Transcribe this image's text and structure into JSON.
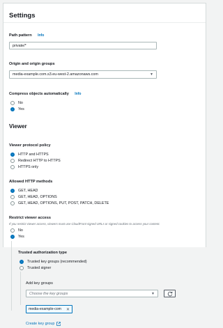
{
  "settings": {
    "title": "Settings"
  },
  "path_pattern": {
    "label": "Path pattern",
    "info": "Info",
    "value": "private/*"
  },
  "origin": {
    "label": "Origin and origin groups",
    "value": "media-example.com.s3.eu-west-2.amazonaws.com"
  },
  "compress": {
    "label": "Compress objects automatically",
    "info": "Info",
    "options": [
      "No",
      "Yes"
    ],
    "selected": "Yes"
  },
  "viewer": {
    "title": "Viewer",
    "protocol": {
      "label": "Viewer protocol policy",
      "options": [
        "HTTP and HTTPS",
        "Redirect HTTP to HTTPS",
        "HTTPS only"
      ],
      "selected": "HTTP and HTTPS"
    },
    "methods": {
      "label": "Allowed HTTP methods",
      "options": [
        "GET, HEAD",
        "GET, HEAD, OPTIONS",
        "GET, HEAD, OPTIONS, PUT, POST, PATCH, DELETE"
      ],
      "selected": "GET, HEAD"
    },
    "restrict": {
      "label": "Restrict viewer access",
      "description": "If you restrict viewer access, viewers must use CloudFront signed URLs or signed cookies to access your content.",
      "options": [
        "No",
        "Yes"
      ],
      "selected": "Yes"
    },
    "trusted": {
      "label": "Trusted authorization type",
      "options": [
        "Trusted key groups (recommended)",
        "Trusted signer"
      ],
      "selected": "Trusted key groups (recommended)"
    },
    "key_groups": {
      "label": "Add key groups",
      "placeholder": "Choose the key groups",
      "selected_tag": "media-example-com",
      "create_link": "Create key group"
    }
  },
  "colors": {
    "accent": "#0073bb",
    "text": "#16191f",
    "border": "#aab7b8",
    "background": "#f2f3f3"
  },
  "icons": {
    "caret": "caret-down-icon",
    "refresh": "refresh-icon",
    "remove": "close-icon",
    "external": "external-link-icon"
  }
}
